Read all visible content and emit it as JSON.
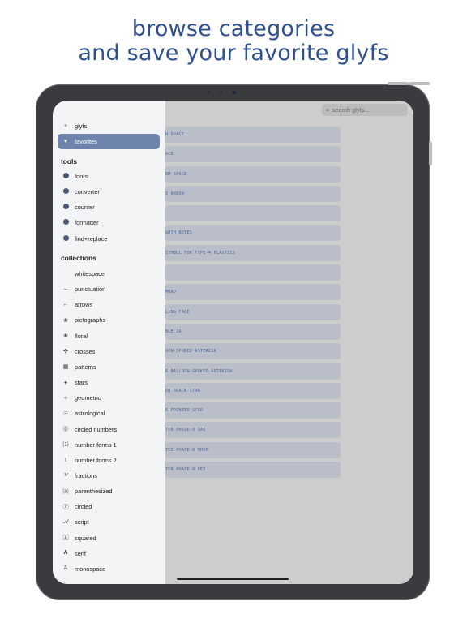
{
  "headline": [
    "browse categories",
    "and save your favorite glyfs"
  ],
  "toolbar": {
    "more": "•••",
    "pin_icon": "pin-icon",
    "settings_icon": "gear-icon",
    "search_placeholder": "search glyfs..."
  },
  "sidebar": {
    "top": [
      {
        "icon": "plus-icon",
        "glyph": "+",
        "label": "glyfs",
        "selected": false
      },
      {
        "icon": "heart-icon",
        "glyph": "♥",
        "label": "favorites",
        "selected": true
      }
    ],
    "tools_title": "tools",
    "tools": [
      {
        "icon": "fonts-icon",
        "label": "fonts"
      },
      {
        "icon": "converter-icon",
        "label": "converter"
      },
      {
        "icon": "counter-icon",
        "label": "counter"
      },
      {
        "icon": "formatter-icon",
        "label": "formatter"
      },
      {
        "icon": "find-replace-icon",
        "label": "find+replace"
      }
    ],
    "collections_title": "collections",
    "collections": [
      {
        "icon": "whitespace-icon",
        "glyph": "",
        "label": "whitespace"
      },
      {
        "icon": "punctuation-icon",
        "glyph": "–",
        "label": "punctuation"
      },
      {
        "icon": "arrow-left-icon",
        "glyph": "←",
        "label": "arrows"
      },
      {
        "icon": "pictograph-icon",
        "glyph": "❀",
        "label": "pictographs"
      },
      {
        "icon": "floral-icon",
        "glyph": "❀",
        "label": "floral"
      },
      {
        "icon": "cross-icon",
        "glyph": "✣",
        "label": "crosses"
      },
      {
        "icon": "pattern-icon",
        "glyph": "▦",
        "label": "patterns"
      },
      {
        "icon": "star-icon",
        "glyph": "✦",
        "label": "stars"
      },
      {
        "icon": "geometric-icon",
        "glyph": "✧",
        "label": "geometric"
      },
      {
        "icon": "astrological-icon",
        "glyph": "☉",
        "label": "astrological"
      },
      {
        "icon": "circled-number-icon",
        "glyph": "⓪",
        "label": "circled numbers"
      },
      {
        "icon": "number-forms-1-icon",
        "glyph": "⑴",
        "label": "number forms 1"
      },
      {
        "icon": "number-forms-2-icon",
        "glyph": "Ⅰ",
        "label": "number forms 2"
      },
      {
        "icon": "fraction-icon",
        "glyph": "⅟",
        "label": "fractions"
      },
      {
        "icon": "parenthesized-icon",
        "glyph": "⒜",
        "label": "parenthesized"
      },
      {
        "icon": "circled-icon",
        "glyph": "ⓐ",
        "label": "circled"
      },
      {
        "icon": "script-icon",
        "glyph": "𝒜",
        "label": "script"
      },
      {
        "icon": "squared-icon",
        "glyph": "🄰",
        "label": "squared"
      },
      {
        "icon": "serif-icon",
        "glyph": "𝐀",
        "label": "serif"
      },
      {
        "icon": "monospace-icon",
        "glyph": "𝙰",
        "label": "monospace"
      }
    ]
  },
  "glyph_rows": [
    "h space",
    "ace",
    "em space",
    "s arrow",
    "",
    "ghth notes",
    "symbol for type-4 plastics",
    "",
    "mond",
    "ling face",
    "ble 2a",
    "oon-spoked asterisk",
    "r balloon-spoked asterisk",
    "ed black star",
    "r pointed star",
    "ter phase-o saq",
    "tee phase-o mhop",
    "ter phase-o pee"
  ]
}
